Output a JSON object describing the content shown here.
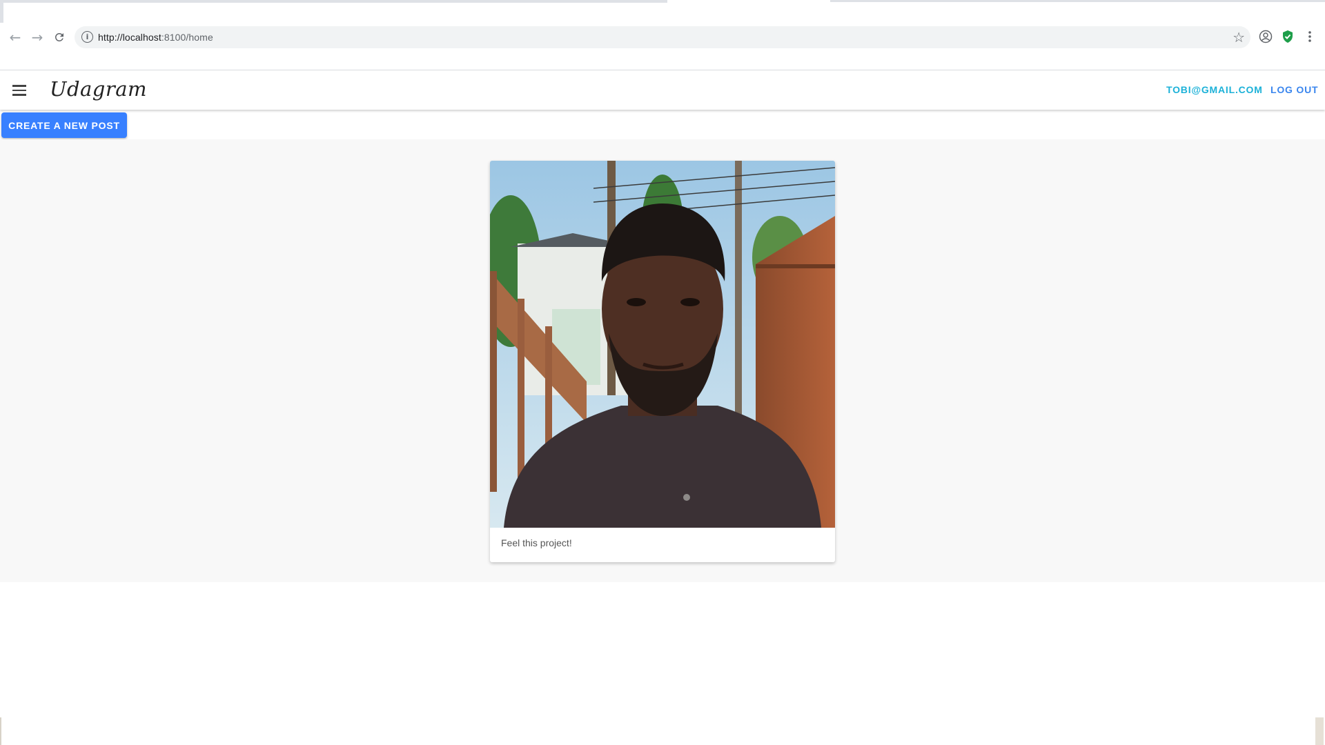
{
  "browser": {
    "url_host": "http://localhost",
    "url_path": ":8100/home",
    "icons": {
      "back": "arrow-left-icon",
      "forward": "arrow-right-icon",
      "reload": "reload-icon",
      "info": "info-icon",
      "bookmark": "star-icon",
      "profile": "profile-icon",
      "extension": "shield-check-icon",
      "menu": "kebab-menu-icon"
    }
  },
  "header": {
    "brand": "Udagram",
    "user_email": "TOBI@GMAIL.COM",
    "logout_label": "LOG OUT"
  },
  "actions": {
    "create_post_label": "CREATE A NEW POST"
  },
  "feed": {
    "posts": [
      {
        "caption": "Feel this project!"
      }
    ]
  },
  "colors": {
    "primary": "#3880ff",
    "email_link": "#1bb1d8",
    "logout_link": "#3a86ee",
    "feed_background": "#f8f8f8"
  }
}
